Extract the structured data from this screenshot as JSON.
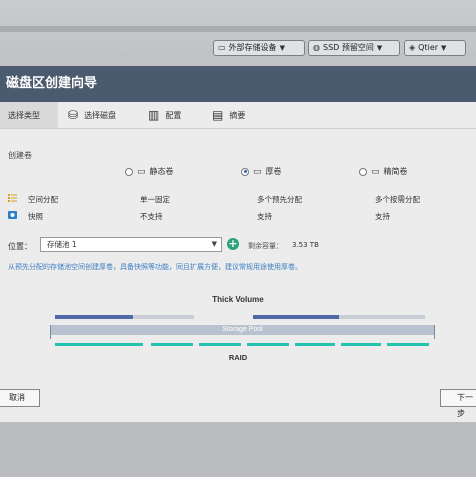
{
  "topbar": {
    "external_storage": "外部存储设备",
    "ssd_cache": "SSD 预留空间",
    "qtier": "Qtier"
  },
  "dialog": {
    "title": "磁盘区创建向导",
    "steps": [
      {
        "label": "选择类型",
        "icon": "volume-type-icon"
      },
      {
        "label": "选择磁盘",
        "icon": "disk-icon"
      },
      {
        "label": "配置",
        "icon": "config-icon"
      },
      {
        "label": "摘要",
        "icon": "summary-icon"
      }
    ],
    "create_volume_label": "创建卷",
    "volume_types": [
      {
        "label": "静态卷",
        "selected": false
      },
      {
        "label": "厚卷",
        "selected": true
      },
      {
        "label": "精简卷",
        "selected": false
      }
    ],
    "features": [
      {
        "label": "空间分配",
        "icon": "space-allocation-icon",
        "values": [
          "单一固定",
          "多个预先分配",
          "多个按需分配"
        ]
      },
      {
        "label": "快照",
        "icon": "snapshot-icon",
        "values": [
          "不支持",
          "支持",
          "支持"
        ]
      }
    ],
    "location_label": "位置：",
    "location_value": "存储池 1",
    "capacity_label": "剩余容量：",
    "capacity_value": "3.53 TB",
    "hint": "从预先分配的存储池空间创建厚卷，具备快照等功能，同且扩展方便，建议常规用途使用厚卷。",
    "diagram": {
      "thick_volume_label": "Thick Volume",
      "storage_pool_label": "Storage Pool",
      "raid_label": "RAID"
    },
    "cancel_label": "取消",
    "next_label": "下一步"
  },
  "colors": {
    "title_bar": "#4a5a6f",
    "thick_volume_used": "#4d6aa6",
    "thick_volume_free": "#c9ced6",
    "storage_pool": "#b9c3cf",
    "raid": "#23c3b0",
    "hint_text": "#3b7fc4",
    "add_button": "#2aa37c"
  }
}
